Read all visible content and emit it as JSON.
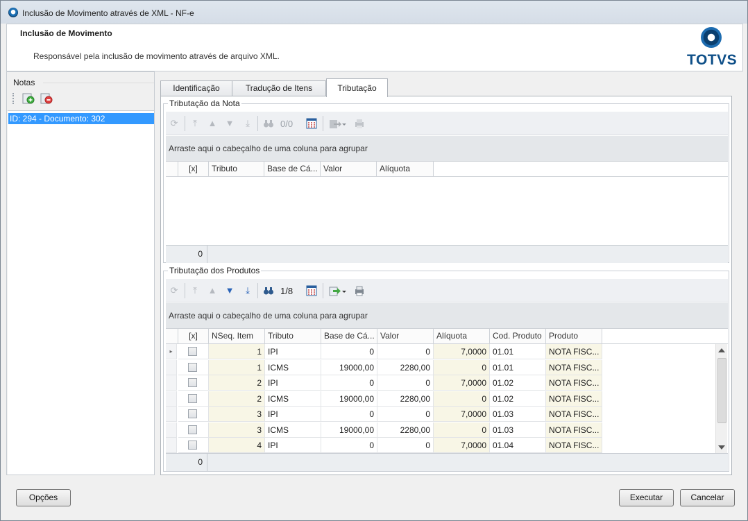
{
  "window": {
    "title": "Inclusão de Movimento através de XML - NF-e"
  },
  "header": {
    "title": "Inclusão de Movimento",
    "description": "Responsável pela inclusão de movimento através de arquivo XML.",
    "logo_text": "TOTVS"
  },
  "notas": {
    "label": "Notas",
    "items": [
      "ID: 294 - Documento: 302"
    ]
  },
  "tabs": [
    "Identificação",
    "Tradução de Itens",
    "Tributação"
  ],
  "tributacao_nota": {
    "legend": "Tributação da Nota",
    "counter": "0/0",
    "groupby_hint": "Arraste aqui o cabeçalho de uma coluna para agrupar",
    "columns": [
      "[x]",
      "Tributo",
      "Base de Cá...",
      "Valor",
      "Alíquota"
    ],
    "footer_count": "0"
  },
  "tributacao_produtos": {
    "legend": "Tributação dos Produtos",
    "counter": "1/8",
    "groupby_hint": "Arraste aqui o cabeçalho de uma coluna para agrupar",
    "columns": [
      "[x]",
      "NSeq. Item",
      "Tributo",
      "Base de Cá...",
      "Valor",
      "Alíquota",
      "Cod. Produto",
      "Produto"
    ],
    "rows": [
      {
        "seq": "1",
        "tributo": "IPI",
        "base": "0",
        "valor": "0",
        "aliquota": "7,0000",
        "cod": "01.01",
        "produto": "NOTA FISC..."
      },
      {
        "seq": "1",
        "tributo": "ICMS",
        "base": "19000,00",
        "valor": "2280,00",
        "aliquota": "0",
        "cod": "01.01",
        "produto": "NOTA FISC..."
      },
      {
        "seq": "2",
        "tributo": "IPI",
        "base": "0",
        "valor": "0",
        "aliquota": "7,0000",
        "cod": "01.02",
        "produto": "NOTA FISC..."
      },
      {
        "seq": "2",
        "tributo": "ICMS",
        "base": "19000,00",
        "valor": "2280,00",
        "aliquota": "0",
        "cod": "01.02",
        "produto": "NOTA FISC..."
      },
      {
        "seq": "3",
        "tributo": "IPI",
        "base": "0",
        "valor": "0",
        "aliquota": "7,0000",
        "cod": "01.03",
        "produto": "NOTA FISC..."
      },
      {
        "seq": "3",
        "tributo": "ICMS",
        "base": "19000,00",
        "valor": "2280,00",
        "aliquota": "0",
        "cod": "01.03",
        "produto": "NOTA FISC..."
      },
      {
        "seq": "4",
        "tributo": "IPI",
        "base": "0",
        "valor": "0",
        "aliquota": "7,0000",
        "cod": "01.04",
        "produto": "NOTA FISC..."
      }
    ],
    "footer_count": "0"
  },
  "buttons": {
    "opcoes": "Opções",
    "executar": "Executar",
    "cancelar": "Cancelar"
  }
}
